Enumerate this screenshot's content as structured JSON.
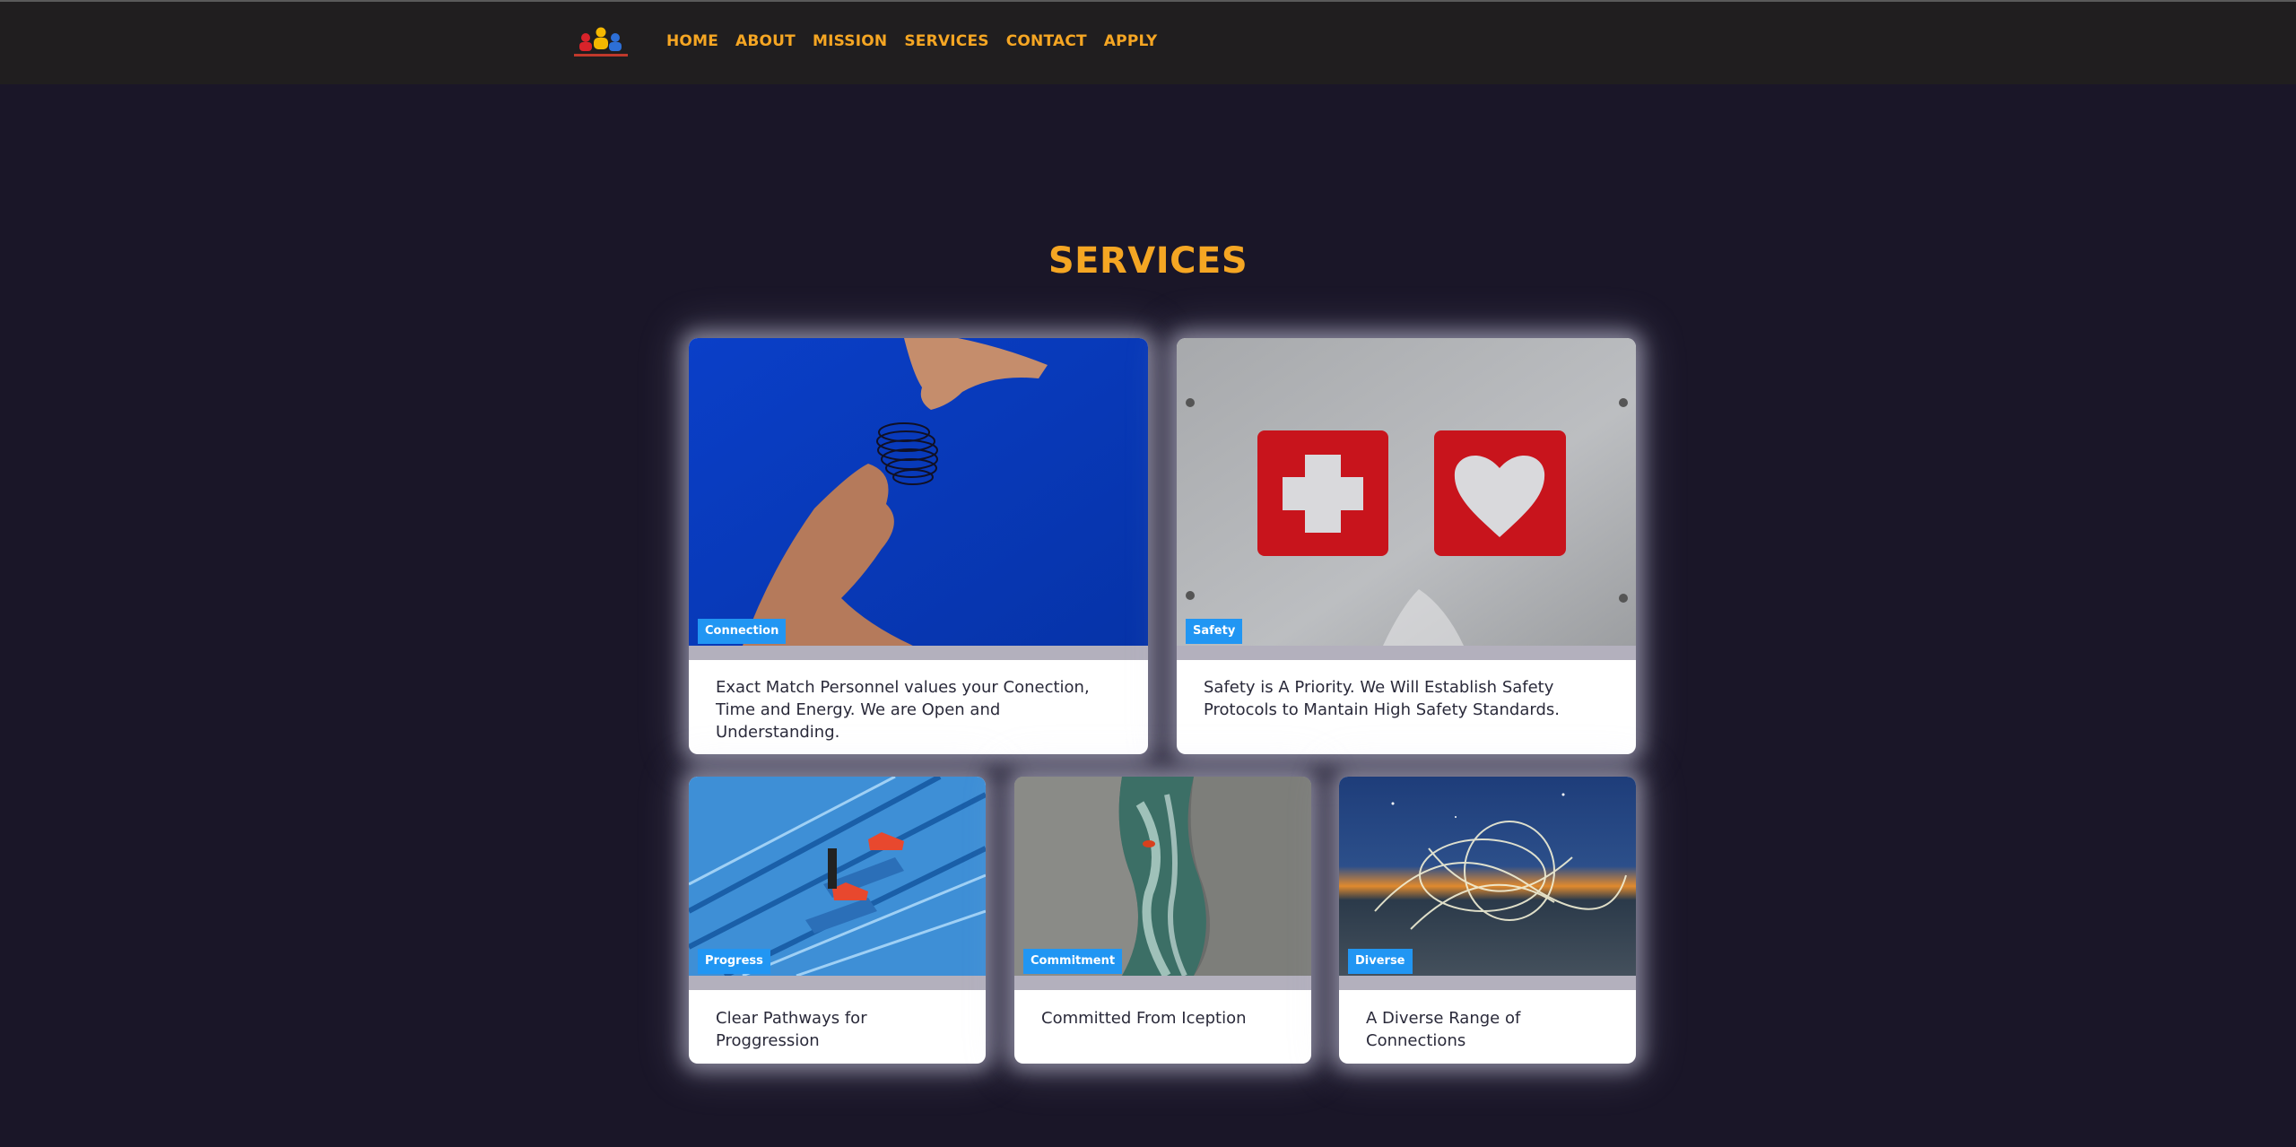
{
  "nav": {
    "links": [
      "HOME",
      "ABOUT",
      "MISSION",
      "SERVICES",
      "CONTACT",
      "APPLY"
    ],
    "accent_color": "#f5a623",
    "background_color": "#201e1f"
  },
  "services": {
    "title": "SERVICES",
    "cards": [
      {
        "badge": "Connection",
        "text": "Exact Match Personnel values your Conection, Time and Energy. We are Open and Understanding."
      },
      {
        "badge": "Safety",
        "text": "Safety is A Priority. We Will Establish Safety Protocols to Mantain High Safety Standards."
      },
      {
        "badge": "Progress",
        "text": "Clear Pathways for Proggression"
      },
      {
        "badge": "Commitment",
        "text": "Committed From Iception"
      },
      {
        "badge": "Diverse",
        "text": "A Diverse Range of Connections"
      }
    ],
    "badge_color": "#2196f3",
    "page_background": "#1a1628"
  }
}
